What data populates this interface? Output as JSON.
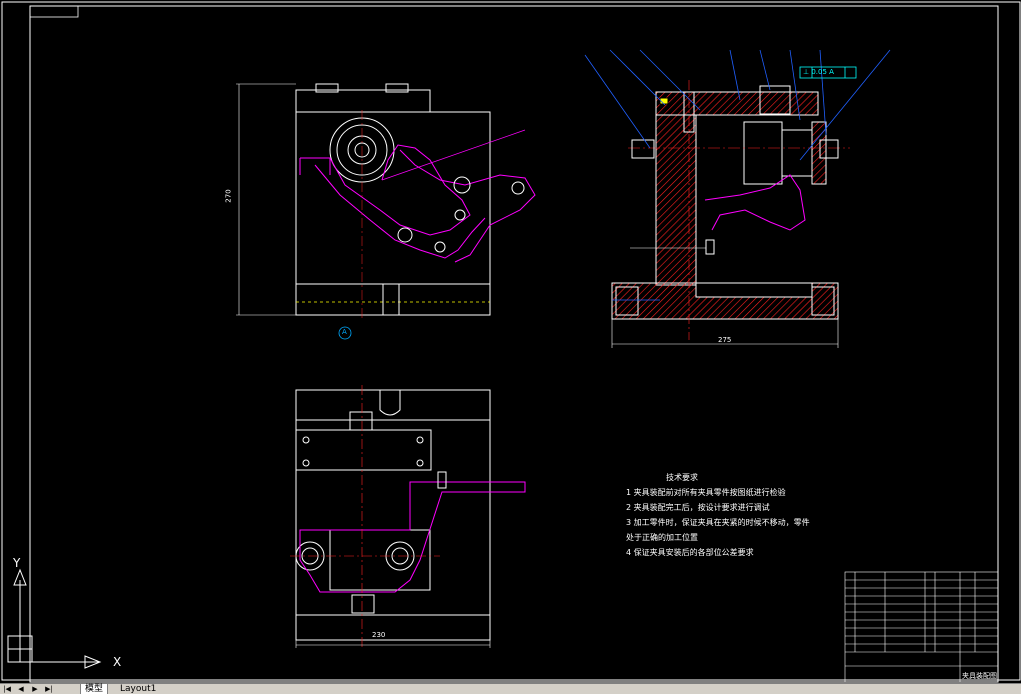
{
  "drawing": {
    "tech_title": "技术要求",
    "tech_requirements": [
      "1  夹具装配前对所有夹具零件按图纸进行检验",
      "2  夹具装配完工后，按设计要求进行调试",
      "3  加工零件时，保证夹具在夹紧的时候不移动，零件",
      "    处于正确的加工位置",
      "4  保证夹具安装后的各部位公差要求"
    ],
    "dim_front_height": "270",
    "dim_side_width": "275",
    "dim_plan_width": "230",
    "section_marker": "A",
    "tolerance_frame": "⊥ 0.05 A",
    "title_block_name": "夹具装配图",
    "ucs_x": "X",
    "ucs_y": "Y"
  },
  "layout_tabs": {
    "nav": [
      "|◀",
      "◀",
      "▶",
      "▶|"
    ],
    "tabs": [
      "模型",
      "Layout1"
    ]
  },
  "colors": {
    "background": "#000000",
    "geometry": "#ffffff",
    "magenta": "#ff00ff",
    "hatch": "#ff0000",
    "leader": "#0000ff",
    "centerline": "#ff0000",
    "annotation": "#00ffff",
    "highlight": "#ffff00"
  }
}
